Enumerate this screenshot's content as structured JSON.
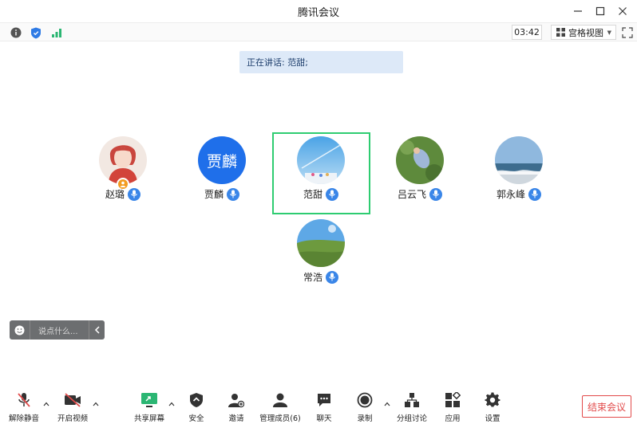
{
  "window": {
    "title": "腾讯会议"
  },
  "infobar": {
    "timer": "03:42",
    "view_label": "宫格视图"
  },
  "speaking_banner": "正在讲话: 范甜;",
  "participants": [
    {
      "name": "赵璐",
      "avatar_icon": "woman-avatar-icon",
      "host": true
    },
    {
      "name": "贾麟",
      "avatar_text": "贾麟"
    },
    {
      "name": "范甜",
      "avatar_icon": "sky-avatar-icon",
      "speaking": true
    },
    {
      "name": "吕云飞",
      "avatar_icon": "field-avatar-icon"
    },
    {
      "name": "郭永峰",
      "avatar_icon": "sea-avatar-icon"
    },
    {
      "name": "常浩",
      "avatar_icon": "grassland-avatar-icon"
    }
  ],
  "chat": {
    "placeholder": "说点什么..."
  },
  "toolbar": {
    "unmute": "解除静音",
    "start_video": "开启视频",
    "share_screen": "共享屏幕",
    "security": "安全",
    "invite": "邀请",
    "manage_members": "管理成员(6)",
    "chat": "聊天",
    "record": "录制",
    "breakout": "分组讨论",
    "apps": "应用",
    "settings": "设置",
    "end_meeting": "结束会议"
  },
  "colors": {
    "accent_blue": "#3a86e8",
    "active_green": "#2ecc71",
    "end_red": "#e24a4a"
  }
}
